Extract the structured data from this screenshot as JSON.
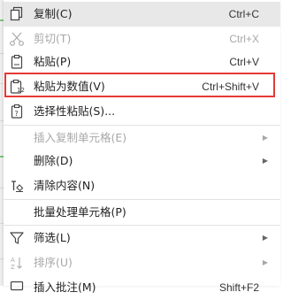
{
  "menu": {
    "items": [
      {
        "label": "复制(C)",
        "shortcut": "Ctrl+C",
        "icon": "copy-icon",
        "enabled": true,
        "hover": true
      },
      {
        "label": "剪切(T)",
        "shortcut": "Ctrl+X",
        "icon": "scissors-icon",
        "enabled": false
      },
      {
        "label": "粘贴(P)",
        "shortcut": "Ctrl+V",
        "icon": "paste-icon",
        "enabled": true
      },
      {
        "label": "粘贴为数值(V)",
        "shortcut": "Ctrl+Shift+V",
        "icon": "paste-values-icon",
        "enabled": true,
        "highlighted": true
      },
      {
        "label": "选择性粘贴(S)...",
        "shortcut": "",
        "icon": "paste-special-icon",
        "enabled": true
      },
      {
        "label": "插入复制单元格(E)",
        "shortcut": "",
        "icon": "",
        "enabled": false,
        "submenu": true
      },
      {
        "label": "删除(D)",
        "shortcut": "",
        "icon": "",
        "enabled": true,
        "submenu": true
      },
      {
        "label": "清除内容(N)",
        "shortcut": "",
        "icon": "eraser-icon",
        "enabled": true
      },
      {
        "label": "批量处理单元格(P)",
        "shortcut": "",
        "icon": "",
        "enabled": true
      },
      {
        "label": "筛选(L)",
        "shortcut": "",
        "icon": "filter-icon",
        "enabled": true,
        "submenu": true
      },
      {
        "label": "排序(U)",
        "shortcut": "",
        "icon": "sort-icon",
        "enabled": false,
        "submenu": true
      },
      {
        "label": "插入批注(M)",
        "shortcut": "Shift+F2",
        "icon": "comment-icon",
        "enabled": true
      }
    ]
  },
  "colors": {
    "highlight_border": "#e53935",
    "hover_bg": "#e8e8e8",
    "disabled_text": "#a8a8a8"
  }
}
